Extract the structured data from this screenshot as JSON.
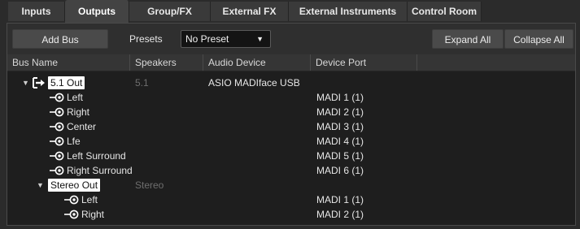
{
  "tabs": [
    {
      "label": "Inputs"
    },
    {
      "label": "Outputs"
    },
    {
      "label": "Group/FX"
    },
    {
      "label": "External FX"
    },
    {
      "label": "External Instruments"
    },
    {
      "label": "Control Room"
    }
  ],
  "toolbar": {
    "add_bus": "Add Bus",
    "presets_label": "Presets",
    "preset_value": "No Preset",
    "expand_all": "Expand All",
    "collapse_all": "Collapse All"
  },
  "columns": [
    "Bus Name",
    "Speakers",
    "Audio Device",
    "Device Port"
  ],
  "buses": [
    {
      "name": "5.1 Out",
      "speakers": "5.1",
      "device": "ASIO MADIface USB",
      "channels": [
        {
          "name": "Left",
          "port": "MADI 1 (1)"
        },
        {
          "name": "Right",
          "port": "MADI 2 (1)"
        },
        {
          "name": "Center",
          "port": "MADI 3 (1)"
        },
        {
          "name": "Lfe",
          "port": "MADI 4 (1)"
        },
        {
          "name": "Left Surround",
          "port": "MADI 5 (1)"
        },
        {
          "name": "Right Surround",
          "port": "MADI 6 (1)"
        }
      ]
    },
    {
      "name": "Stereo Out",
      "speakers": "Stereo",
      "device": "",
      "channels": [
        {
          "name": "Left",
          "port": "MADI 1 (1)"
        },
        {
          "name": "Right",
          "port": "MADI 2 (1)"
        }
      ]
    }
  ],
  "icons": {
    "expand": "triangle-down-icon",
    "output_bus": "output-arrow-icon",
    "channel_port": "port-connector-icon"
  },
  "colors": {
    "background": "#1e1e1e",
    "active_tab": "#434343",
    "bus_label_bg": "#ffffff"
  }
}
